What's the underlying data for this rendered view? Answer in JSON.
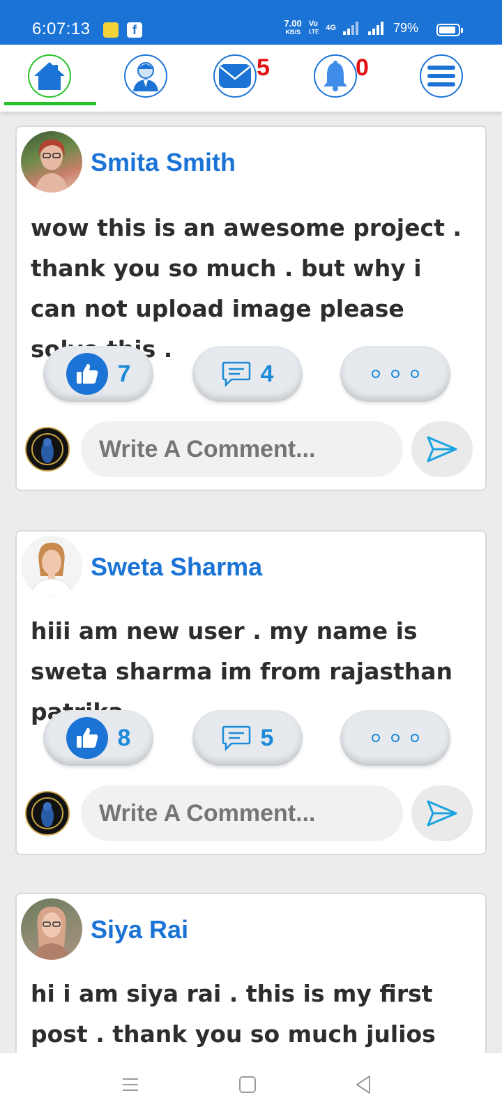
{
  "status_bar": {
    "time": "6:07:13",
    "net_speed_value": "7.00",
    "net_speed_unit": "KB/S",
    "volte_top": "Vo",
    "volte_bottom": "LTE",
    "network_type": "4G",
    "battery_percent": "79%"
  },
  "nav": {
    "mail_count": "5",
    "notification_count": "0",
    "active_tab": "home",
    "accent_color": "#1b73d6",
    "active_color": "#27c22a",
    "badge_color": "#e21111"
  },
  "comment_placeholder": "Write A Comment...",
  "posts": [
    {
      "author": "Smita Smith",
      "text": "wow this is an awesome project . thank you so much . but why i can not upload image please solve this .",
      "likes": "7",
      "comments": "4"
    },
    {
      "author": "Sweta Sharma",
      "text": "hiii am new user . my name is sweta sharma im from rajasthan patrika.",
      "likes": "8",
      "comments": "5"
    },
    {
      "author": "Siya Rai",
      "text": "hi i am siya rai . this is my first post . thank you so much julios for"
    }
  ]
}
